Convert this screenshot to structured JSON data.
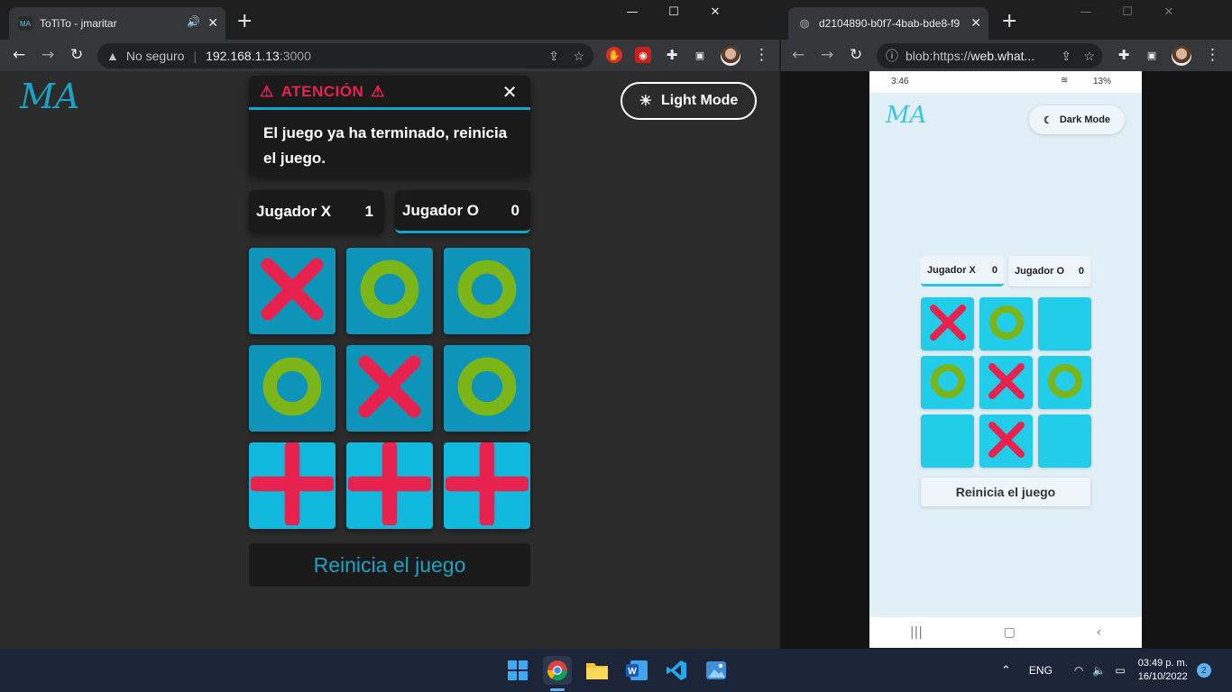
{
  "left_window": {
    "tab_title": "ToTiTo - jmaritar",
    "tab_favicon": "MA",
    "audio_icon": "speaker-icon",
    "address": {
      "security_label": "No seguro",
      "host": "192.168.1.13",
      "port": ":3000"
    },
    "window_controls": {
      "minimize": "—",
      "maximize": "☐",
      "close": "✕"
    }
  },
  "right_window": {
    "tab_title": "d2104890-b0f7-4bab-bde8-f9",
    "address": {
      "prefix": "blob:https://",
      "host": "web.what..."
    },
    "window_controls": {
      "minimize": "—",
      "maximize": "☐",
      "close": "✕"
    }
  },
  "app": {
    "logo_text": "MA",
    "mode_button_label": "Light Mode",
    "mode_icon": "sun-icon",
    "alert": {
      "title": "ATENCIÓN",
      "icon": "warning-icon",
      "message": "El juego ya ha terminado, reinicia el juego."
    },
    "players": [
      {
        "name": "Jugador X",
        "score": "1"
      },
      {
        "name": "Jugador O",
        "score": "0"
      }
    ],
    "board": [
      "X",
      "O",
      "O",
      "O",
      "X",
      "O",
      "+",
      "+",
      "+"
    ],
    "reset_label": "Reinicia el juego",
    "colors": {
      "x": "#e8224f",
      "o": "#7cb518",
      "cell": "#0e93b9",
      "cell_win": "#0fb8dc",
      "accent": "#0fa4c9"
    }
  },
  "phone": {
    "status_time": "3:46",
    "battery": "13%",
    "logo_text": "MA",
    "mode_button_label": "Dark Mode",
    "mode_icon": "moon-icon",
    "players": [
      {
        "name": "Jugador X",
        "score": "0"
      },
      {
        "name": "Jugador O",
        "score": "0"
      }
    ],
    "board": [
      "X",
      "O",
      "",
      "O",
      "X",
      "O",
      "",
      "X",
      ""
    ],
    "reset_label": "Reinicia el juego"
  },
  "taskbar": {
    "apps": [
      "chrome-icon",
      "file-explorer-icon",
      "word-icon",
      "vscode-icon",
      "photos-icon"
    ],
    "language": "ENG",
    "time": "03:49 p. m.",
    "date": "16/10/2022",
    "notifications": "2"
  }
}
